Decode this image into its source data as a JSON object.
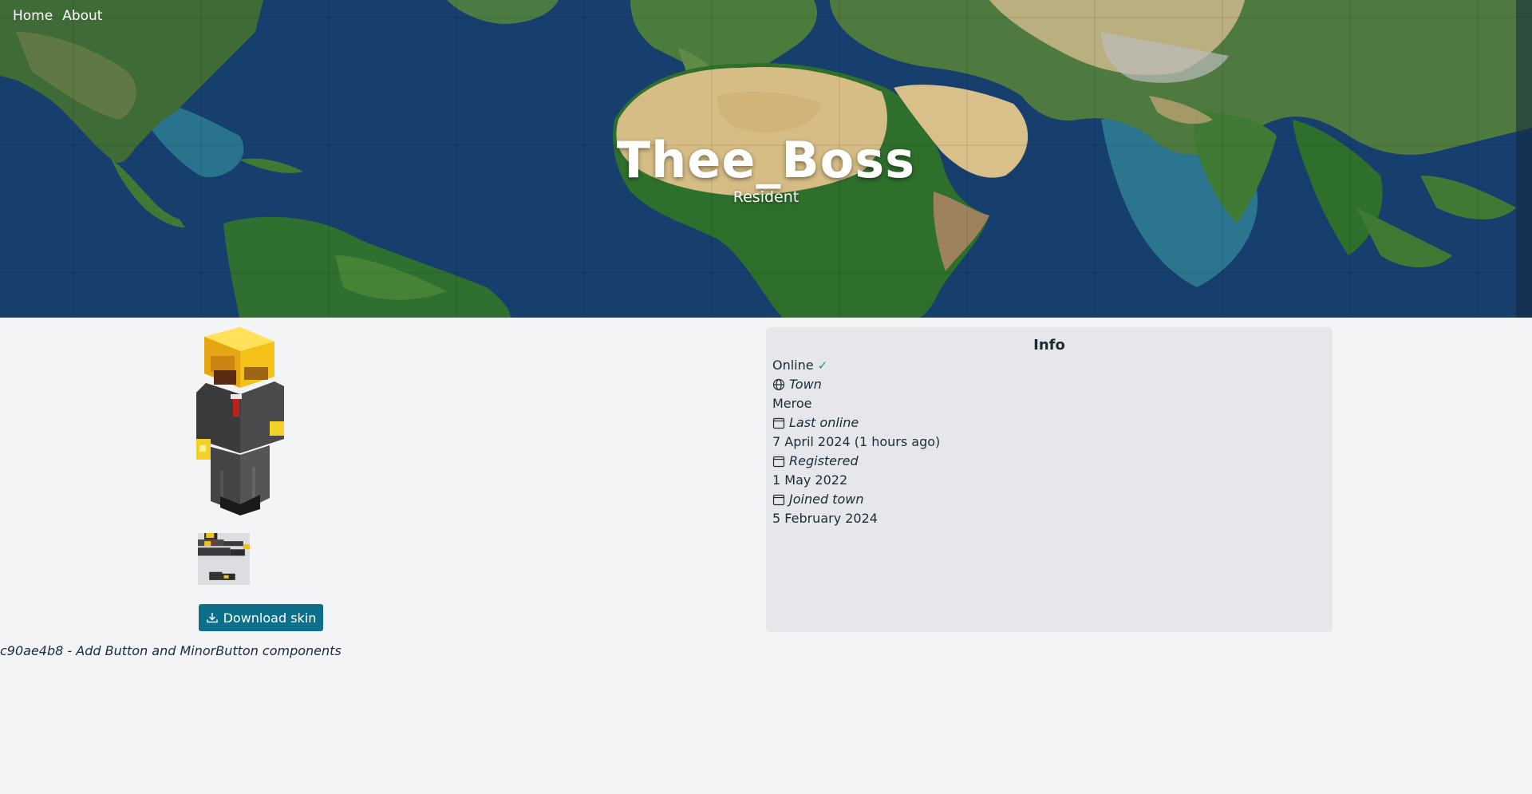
{
  "nav": {
    "items": [
      {
        "label": "Home"
      },
      {
        "label": "About"
      }
    ]
  },
  "hero": {
    "title": "Thee_Boss",
    "subtitle": "Resident"
  },
  "skin": {
    "download_label": "Download skin",
    "download_icon": "download-icon"
  },
  "info": {
    "heading": "Info",
    "status": "Online",
    "status_icon": "check-icon",
    "town_label": "Town",
    "town_icon": "globe-icon",
    "town_value": "Meroe",
    "last_online_label": "Last online",
    "last_online_value": "7 April 2024 (1 hours ago)",
    "registered_label": "Registered",
    "registered_value": "1 May 2022",
    "joined_town_label": "Joined town",
    "joined_town_value": "5 February 2024",
    "calendar_icon": "calendar-icon"
  },
  "footer": {
    "commit_text": "c90ae4b8 - Add Button and MinorButton components"
  },
  "colors": {
    "accent_button": "#0e6f8a",
    "online_check": "#16a34a",
    "panel_bg": "#e5e7eb",
    "page_bg": "#f3f4f6"
  }
}
